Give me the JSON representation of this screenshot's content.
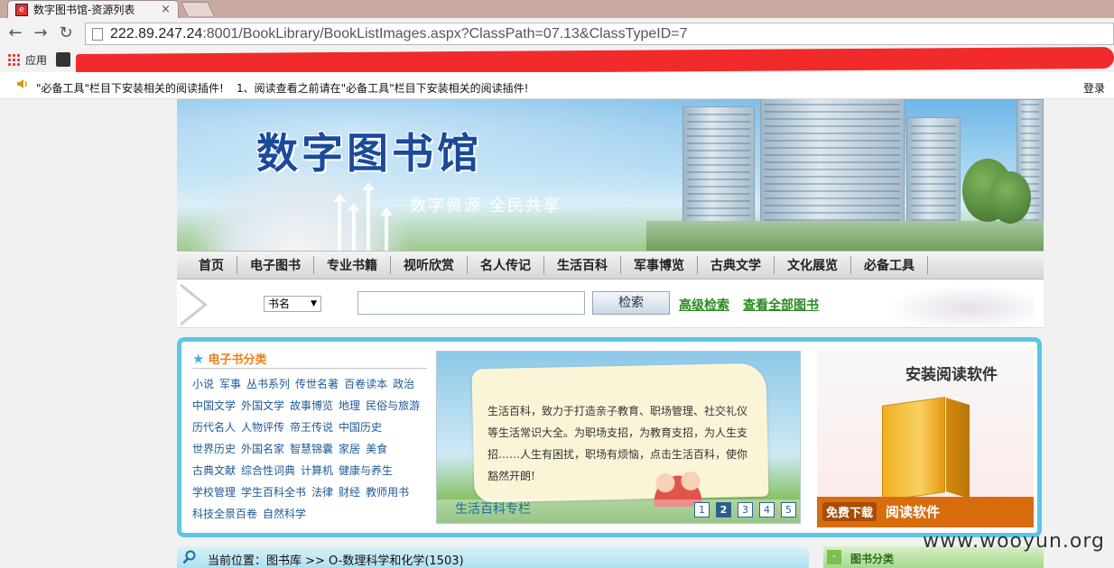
{
  "browser": {
    "tab_title": "数字图书馆-资源列表",
    "tab_close": "×",
    "url_host": "222.89.247.24",
    "url_rest": ":8001/BookLibrary/BookListImages.aspx?ClassPath=07.13&ClassTypeID=7",
    "bookmarks_apps_label": "应用",
    "infobar_msg1": "\"必备工具\"栏目下安装相关的阅读插件!",
    "infobar_msg2": "1、阅读查看之前请在\"必备工具\"栏目下安装相关的阅读插件!",
    "login_label": "登录"
  },
  "banner": {
    "title": "数字图书馆",
    "slogan": "数字资源  全民共享"
  },
  "nav": {
    "items": [
      "首页",
      "电子图书",
      "专业书籍",
      "视听欣赏",
      "名人传记",
      "生活百科",
      "军事博览",
      "古典文学",
      "文化展览",
      "必备工具"
    ]
  },
  "search": {
    "field_option": "书名",
    "input_value": "",
    "button_label": "检索",
    "advanced_link": "高级检索",
    "view_all_link": "查看全部图书"
  },
  "categories": {
    "title": "电子书分类",
    "lines": [
      [
        "小说",
        "军事",
        "丛书系列",
        "传世名著",
        "百卷读本",
        "政治"
      ],
      [
        "中国文学",
        "外国文学",
        "故事博览",
        "地理",
        "民俗与旅游"
      ],
      [
        "历代名人",
        "人物评传",
        "帝王传说",
        "中国历史"
      ],
      [
        "世界历史",
        "外国名家",
        "智慧锦囊",
        "家居",
        "美食"
      ],
      [
        "古典文献",
        "综合性词典",
        "计算机",
        "健康与养生"
      ],
      [
        "学校管理",
        "学生百科全书",
        "法律",
        "财经",
        "教师用书"
      ],
      [
        "科技全景百卷",
        "自然科学"
      ]
    ]
  },
  "slider": {
    "text": "生活百科，致力于打造亲子教育、职场管理、社交礼仪等生活常识大全。为职场支招，为教育支招，为人生支招……人生有困扰，职场有烦恼，点击生活百科，使你豁然开朗!",
    "caption": "生活百科专栏",
    "pages": [
      "1",
      "2",
      "3",
      "4",
      "5"
    ],
    "active_page": "2"
  },
  "install": {
    "title": "安装阅读软件",
    "badge": "免费下载",
    "text": "阅读软件"
  },
  "breadcrumb": {
    "text": "当前位置：图书库 >> O-数理科学和化学(1503)"
  },
  "side": {
    "title": "图书分类",
    "toggle": "-"
  },
  "watermark": "www.wooyun.org"
}
